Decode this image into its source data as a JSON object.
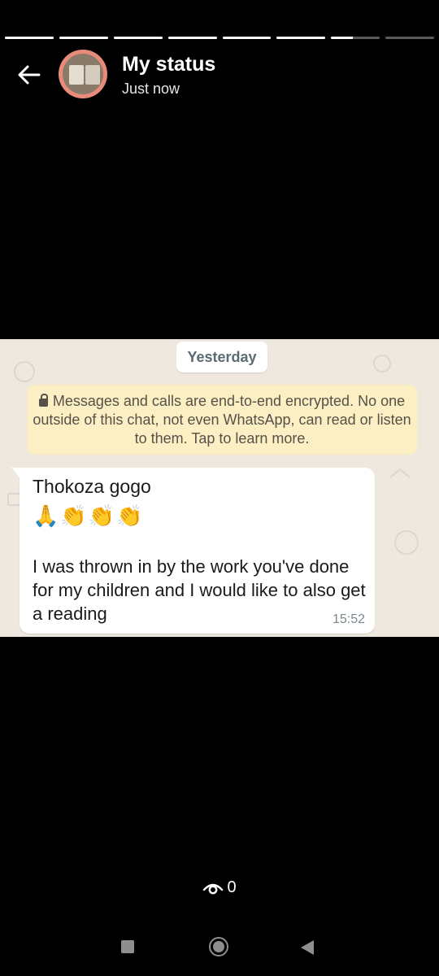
{
  "status": {
    "segments_fill": [
      1,
      1,
      1,
      1,
      1,
      1,
      0.45,
      0
    ],
    "title": "My status",
    "subtitle": "Just now"
  },
  "screenshot": {
    "date_pill": "Yesterday",
    "encryption_notice": "Messages and calls are end-to-end encrypted. No one outside of this chat, not even WhatsApp, can read or listen to them. Tap to learn more.",
    "message": {
      "title": "Thokoza gogo",
      "emojis": "🙏👏👏👏",
      "body": "I was thrown in by the work you've done for my children and I would like to also get a reading",
      "time": "15:52"
    }
  },
  "footer": {
    "views_count": "0"
  },
  "colors": {
    "background": "#000000",
    "chat_background": "#efe8df",
    "encryption_bubble": "#fcefc3"
  }
}
